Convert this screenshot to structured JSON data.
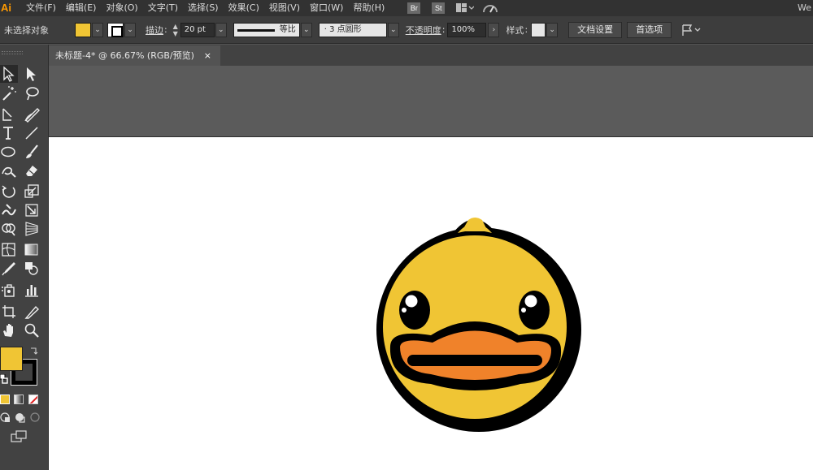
{
  "app": {
    "logo": "Ai",
    "menu": [
      "文件(F)",
      "编辑(E)",
      "对象(O)",
      "文字(T)",
      "选择(S)",
      "效果(C)",
      "视图(V)",
      "窗口(W)",
      "帮助(H)"
    ],
    "app_icons": [
      "Br",
      "St"
    ],
    "workspace_text": "We"
  },
  "control": {
    "selection_status": "未选择对象",
    "fill_color": "#f0c534",
    "stroke_label": "描边",
    "stroke_value": "20 pt",
    "stroke_profile": "等比",
    "brush": "3 点圆形",
    "opacity_label": "不透明度",
    "opacity_value": "100%",
    "style_label": "样式",
    "doc_setup": "文档设置",
    "preferences": "首选项"
  },
  "document": {
    "tab_title": "未标题-4* @ 66.67% (RGB/预览)",
    "close_glyph": "×"
  },
  "colors": {
    "fill_swatch": "#f0c534",
    "duck_body": "#f0c534",
    "duck_beak": "#f0822a",
    "outline": "#000000",
    "accent": "#ff9a00"
  },
  "tools": [
    "selection-tool-icon",
    "direct-selection-tool-icon",
    "magic-wand-tool-icon",
    "lasso-tool-icon",
    "pen-tool-icon",
    "curvature-tool-icon",
    "type-tool-icon",
    "line-tool-icon",
    "ellipse-tool-icon",
    "paintbrush-tool-icon",
    "shaper-tool-icon",
    "eraser-tool-icon",
    "rotate-tool-icon",
    "scale-tool-icon",
    "warp-tool-icon",
    "free-transform-tool-icon",
    "shape-builder-tool-icon",
    "perspective-grid-tool-icon",
    "mesh-tool-icon",
    "gradient-tool-icon",
    "eyedropper-tool-icon",
    "blend-tool-icon",
    "symbol-sprayer-tool-icon",
    "column-graph-tool-icon",
    "artboard-tool-icon",
    "slice-tool-icon",
    "hand-tool-icon",
    "zoom-tool-icon"
  ]
}
